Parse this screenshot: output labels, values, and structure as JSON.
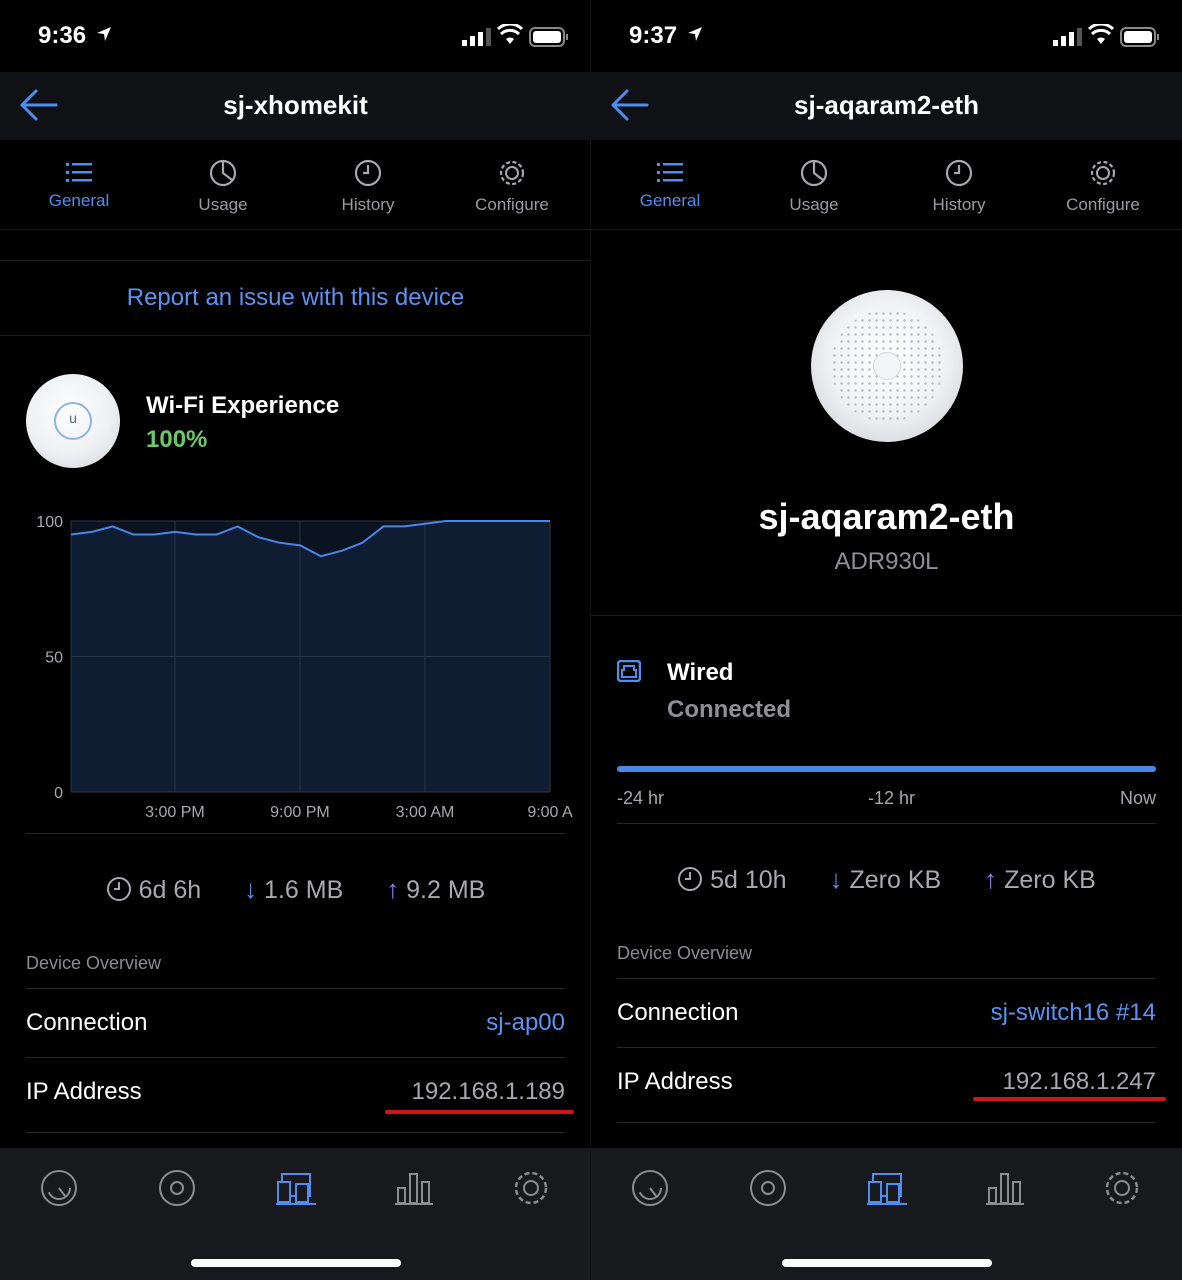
{
  "left": {
    "time": "9:36",
    "title": "sj-xhomekit",
    "tabs": [
      {
        "label": "General",
        "active": true
      },
      {
        "label": "Usage",
        "active": false
      },
      {
        "label": "History",
        "active": false
      },
      {
        "label": "Configure",
        "active": false
      }
    ],
    "report_link": "Report an issue with this device",
    "wifi_experience_label": "Wi-Fi Experience",
    "wifi_experience_value": "100%",
    "stats": {
      "uptime": "6d 6h",
      "download": "1.6 MB",
      "upload": "9.2 MB"
    },
    "overview_heading": "Device Overview",
    "rows": [
      {
        "key": "Connection",
        "value": "sj-ap00",
        "link": true
      },
      {
        "key": "IP Address",
        "value": "192.168.1.189",
        "link": false
      }
    ]
  },
  "right": {
    "time": "9:37",
    "title": "sj-aqaram2-eth",
    "tabs": [
      {
        "label": "General",
        "active": true
      },
      {
        "label": "Usage",
        "active": false
      },
      {
        "label": "History",
        "active": false
      },
      {
        "label": "Configure",
        "active": false
      }
    ],
    "device_name": "sj-aqaram2-eth",
    "device_model": "ADR930L",
    "connection_type": "Wired",
    "connection_status": "Connected",
    "uptime_bar": {
      "fill_fraction": 1.0,
      "labels": [
        "-24 hr",
        "-12 hr",
        "Now"
      ]
    },
    "stats": {
      "uptime": "5d 10h",
      "download": "Zero KB",
      "upload": "Zero KB"
    },
    "overview_heading": "Device Overview",
    "rows": [
      {
        "key": "Connection",
        "value": "sj-switch16 #14",
        "link": true
      },
      {
        "key": "IP Address",
        "value": "192.168.1.247",
        "link": false
      }
    ]
  },
  "chart_data": {
    "type": "line",
    "title": "",
    "xlabel": "",
    "ylabel": "",
    "ylim": [
      0,
      100
    ],
    "yticks": [
      "100",
      "50",
      "0"
    ],
    "xticks": [
      "3:00 PM",
      "9:00 PM",
      "3:00 AM",
      "9:00 A"
    ],
    "x": [
      0,
      1,
      2,
      3,
      4,
      5,
      6,
      7,
      8,
      9,
      10,
      11,
      12,
      13,
      14,
      15,
      16,
      17,
      18,
      19,
      20,
      21,
      22,
      23
    ],
    "series": [
      {
        "values": [
          95,
          96,
          98,
          95,
          95,
          96,
          95,
          95,
          98,
          94,
          92,
          91,
          87,
          89,
          92,
          98,
          98,
          99,
          100,
          100,
          100,
          100,
          100,
          100
        ]
      }
    ],
    "grid": true
  },
  "colors": {
    "accent": "#4f8ef0",
    "link": "#5b93f0",
    "good": "#6bc86b",
    "underline": "#d0141b",
    "line": "#4a86e8"
  }
}
